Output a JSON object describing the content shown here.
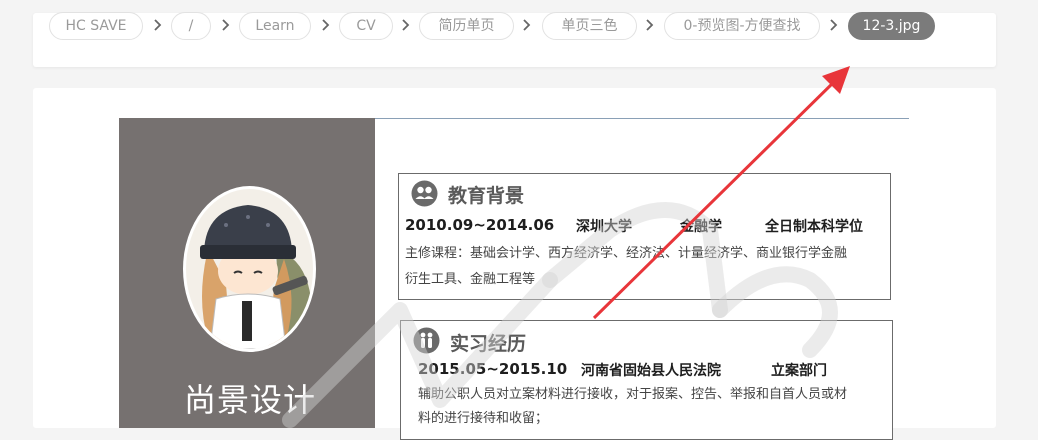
{
  "breadcrumb": {
    "items": [
      "HC SAVE",
      "/",
      "Learn",
      "CV",
      "简历单页",
      "单页三色",
      "0-预览图-方便查找"
    ],
    "current": "12-3.jpg",
    "separator": "›"
  },
  "resume": {
    "brand": "尚景设计",
    "education": {
      "title": "教育背景",
      "date": "2010.09~2014.06",
      "school": "深圳大学",
      "major": "金融学",
      "degree": "全日制本科学位",
      "courses_line1": "主修课程：基础会计学、西方经济学、经济法、计量经济学、商业银行学金融",
      "courses_line2": "衍生工具、金融工程等"
    },
    "internship": {
      "title": "实习经历",
      "date": "2015.05~2015.10",
      "org": "河南省固始县人民法院",
      "dept": "立案部门",
      "desc_line1": "辅助公职人员对立案材料进行接收，对于报案、控告、举报和自首人员或材",
      "desc_line2": "料的进行接待和收留；"
    }
  },
  "colors": {
    "sidebar": "#767170",
    "active_crumb": "#7b7b7b",
    "arrow": "#e8353a",
    "rule": "#8aa0b6"
  },
  "icons": [
    "chevron-right-icon",
    "graduation-users-icon",
    "people-icon",
    "annotation-arrow-icon"
  ]
}
